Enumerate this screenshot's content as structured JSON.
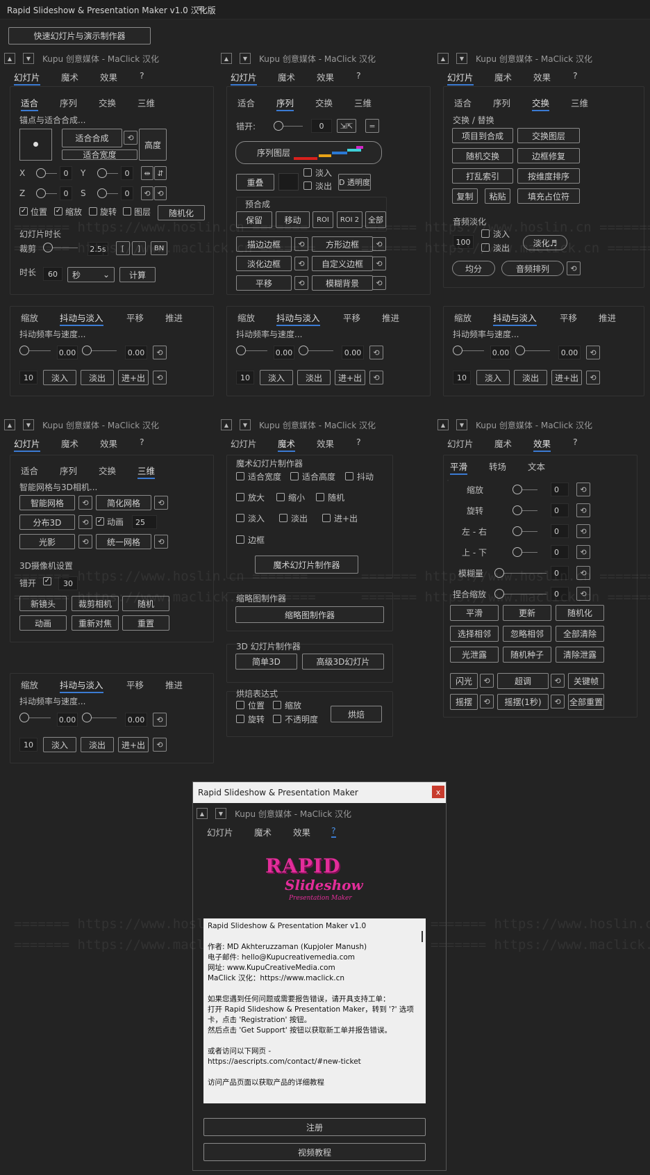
{
  "app": {
    "title": "Rapid Slideshow & Presentation Maker v1.0 汉化版",
    "menu_glyph": "≡",
    "top_button": "快速幻灯片与演示制作器"
  },
  "panel_header": "Kupu 创意媒体 - MaClick 汉化",
  "main_tabs": [
    "幻灯片",
    "魔术",
    "效果",
    "?"
  ],
  "sub_tabs": [
    "适合",
    "序列",
    "交换",
    "三维"
  ],
  "anim_tabs": [
    "缩放",
    "抖动与淡入",
    "平移",
    "推进"
  ],
  "anim": {
    "section": "抖动频率与速度...",
    "val1": "0.00",
    "val2": "0.00",
    "count": "10",
    "fade_in": "淡入",
    "fade_out": "淡出",
    "in_out": "进+出"
  },
  "fit": {
    "section": "锚点与适合合成...",
    "fit_comp": "适合合成",
    "fit_width": "适合宽度",
    "height": "高度",
    "x": "X",
    "y": "Y",
    "z": "Z",
    "s": "S",
    "xv": "0",
    "yv": "0",
    "zv": "0",
    "sv": "0",
    "position": "位置",
    "scale": "缩放",
    "rotate": "旋转",
    "layer": "图层",
    "randomize": "随机化",
    "duration_section": "幻灯片时长",
    "trim": "裁剪",
    "trim_val": "2.5s",
    "bn": "BN",
    "duration": "时长",
    "duration_val": "60",
    "unit": "秒",
    "calc": "计算"
  },
  "seq": {
    "stagger": "错开:",
    "stagger_val": "0",
    "sequence": "序列图层",
    "overlap": "重叠",
    "fade_in": "淡入",
    "fade_out": "淡出",
    "opacity": "D 透明度",
    "precomp": "预合成",
    "keep": "保留",
    "move": "移动",
    "roi": "ROI",
    "roi2": "ROI 2",
    "all": "全部",
    "stroke_border": "描边边框",
    "square_border": "方形边框",
    "fade_border": "淡化边框",
    "custom_border": "自定义边框",
    "pan": "平移",
    "blur_bg": "模糊背景"
  },
  "swap": {
    "section": "交换 / 替换",
    "item_to_comp": "项目到合成",
    "swap_layers": "交换图层",
    "random_swap": "随机交换",
    "fix_border": "边框修复",
    "index": "打乱索引",
    "dim_sort": "按维度排序",
    "copy": "复制",
    "paste": "粘贴",
    "fill_placeholder": "填充占位符",
    "audio_section": "音频淡化",
    "audio_val": "100",
    "fade_in": "淡入",
    "fade_out": "淡出",
    "fade": "淡化♬",
    "split": "均分",
    "audio_seq": "音频排列"
  },
  "three_d": {
    "section": "智能网格与3D相机...",
    "smart_grid": "智能网格",
    "simple_grid": "简化网格",
    "distribute": "分布3D",
    "animate": "动画",
    "animate_val": "25",
    "light": "光影",
    "unify": "统一网格",
    "camera_section": "3D摄像机设置",
    "stagger": "错开",
    "stagger_val": "30",
    "new_lens": "新镜头",
    "cut_camera": "裁剪相机",
    "random": "随机",
    "anim": "动画",
    "refocus": "重新对焦",
    "reset": "重置"
  },
  "magic": {
    "section": "魔术幻灯片制作器",
    "fit_width": "适合宽度",
    "fit_height": "适合高度",
    "shake": "抖动",
    "zoom_in": "放大",
    "zoom_out": "缩小",
    "random": "随机",
    "fade_in": "淡入",
    "fade_out": "淡出",
    "in_out": "进+出",
    "border": "边框",
    "maker": "魔术幻灯片制作器",
    "thumb_section": "缩略图制作器",
    "thumb": "缩略图制作器",
    "d3_section": "3D 幻灯片制作器",
    "simple3d": "简单3D",
    "adv3d": "高级3D幻灯片",
    "bake_section": "烘焙表达式",
    "pos": "位置",
    "scale": "缩放",
    "rot": "旋转",
    "opacity": "不透明度",
    "bake": "烘焙"
  },
  "effects": {
    "tabs": [
      "平滑",
      "转场",
      "文本"
    ],
    "rows": [
      {
        "label": "缩放",
        "val": "0"
      },
      {
        "label": "旋转",
        "val": "0"
      },
      {
        "label": "左 - 右",
        "val": "0"
      },
      {
        "label": "上 - 下",
        "val": "0"
      },
      {
        "label": "模糊量",
        "val": "0"
      },
      {
        "label": "捏合缩放",
        "val": "0"
      }
    ],
    "smooth": "平滑",
    "update": "更新",
    "randomize": "随机化",
    "select_adj": "选择相邻",
    "ignore_adj": "忽略相邻",
    "clear_all": "全部清除",
    "light_leak": "光泄露",
    "random_seed": "随机种子",
    "clear_leak": "清除泄露",
    "flash": "闪光",
    "overshoot": "超调",
    "keyframe": "关键帧",
    "wiggle": "摇摆",
    "wiggle1": "摇摆(1秒)",
    "reset_all": "全部重置"
  },
  "dialog": {
    "title": "Rapid Slideshow & Presentation Maker",
    "close": "x",
    "logo1": "RAPID",
    "logo2": "Slideshow",
    "logo3": "Presentation Maker",
    "lines": [
      "Rapid Slideshow & Presentation Maker v1.0",
      "",
      "作者: MD Akhteruzzaman (Kupjoler Manush)",
      "电子邮件: hello@Kupucreativemedia.com",
      "网址: www.KupuCreativeMedia.com",
      "MaClick 汉化：https://www.maclick.cn",
      "",
      "如果您遇到任何问题或需要报告错误，请开具支持工单：",
      "打开 Rapid Slideshow & Presentation Maker，转到 '?' 选项",
      "卡，点击 'Registration' 按钮。",
      "然后点击 'Get Support' 按钮以获取新工单并报告错误。",
      "",
      "或者访问以下网页 -",
      "https://aescripts.com/contact/#new-ticket",
      "",
      "访问产品页面以获取产品的详细教程"
    ],
    "register": "注册",
    "video": "视频教程"
  },
  "watermark": {
    "a": "======= https://www.hoslin.cn =======",
    "b": "======= https://www.maclick.cn ======="
  }
}
